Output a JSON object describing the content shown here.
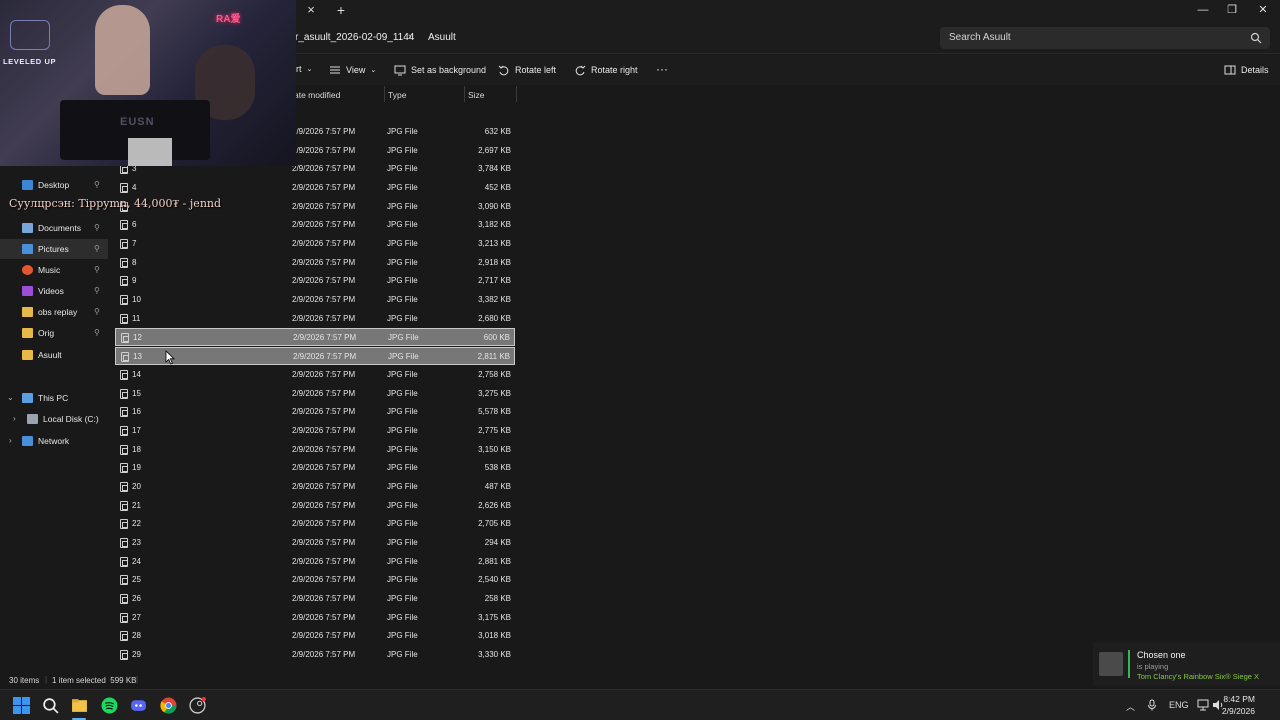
{
  "window": {
    "tab_close": "×",
    "new_tab": "+",
    "minimize": "—",
    "maximize": "❐",
    "close": "✕"
  },
  "address": {
    "crumb_parent": "r_asuult_2026-02-09_1144",
    "crumb_current": "Asuult",
    "search_placeholder": "Search Asuult"
  },
  "toolbar": {
    "sort_label": "rt",
    "view_label": "View",
    "set_background_label": "Set as background",
    "rotate_left_label": "Rotate left",
    "rotate_right_label": "Rotate right",
    "more_label": "···",
    "details_label": "Details"
  },
  "columns": {
    "date": "ate modified",
    "type": "Type",
    "size": "Size"
  },
  "nav": {
    "desktop": "Desktop",
    "documents": "Documents",
    "pictures": "Pictures",
    "music": "Music",
    "videos": "Videos",
    "obs_replay": "obs replay",
    "orig": "Orig",
    "asuult": "Asuult",
    "this_pc": "This PC",
    "local_disk": "Local Disk (C:)",
    "network": "Network"
  },
  "files": [
    {
      "name": "",
      "date": "2/9/2026 7:57 PM",
      "type": "JPG File",
      "size": "632 KB"
    },
    {
      "name": "",
      "date": "2/9/2026 7:57 PM",
      "type": "JPG File",
      "size": "2,697 KB"
    },
    {
      "name": "3",
      "date": "2/9/2026 7:57 PM",
      "type": "JPG File",
      "size": "3,784 KB"
    },
    {
      "name": "4",
      "date": "2/9/2026 7:57 PM",
      "type": "JPG File",
      "size": "452 KB"
    },
    {
      "name": "",
      "date": "2/9/2026 7:57 PM",
      "type": "JPG File",
      "size": "3,090 KB"
    },
    {
      "name": "6",
      "date": "2/9/2026 7:57 PM",
      "type": "JPG File",
      "size": "3,182 KB"
    },
    {
      "name": "7",
      "date": "2/9/2026 7:57 PM",
      "type": "JPG File",
      "size": "3,213 KB"
    },
    {
      "name": "8",
      "date": "2/9/2026 7:57 PM",
      "type": "JPG File",
      "size": "2,918 KB"
    },
    {
      "name": "9",
      "date": "2/9/2026 7:57 PM",
      "type": "JPG File",
      "size": "2,717 KB"
    },
    {
      "name": "10",
      "date": "2/9/2026 7:57 PM",
      "type": "JPG File",
      "size": "3,382 KB"
    },
    {
      "name": "11",
      "date": "2/9/2026 7:57 PM",
      "type": "JPG File",
      "size": "2,680 KB"
    },
    {
      "name": "12",
      "date": "2/9/2026 7:57 PM",
      "type": "JPG File",
      "size": "600 KB",
      "selected": true
    },
    {
      "name": "13",
      "date": "2/9/2026 7:57 PM",
      "type": "JPG File",
      "size": "2,811 KB",
      "selected": true
    },
    {
      "name": "14",
      "date": "2/9/2026 7:57 PM",
      "type": "JPG File",
      "size": "2,758 KB"
    },
    {
      "name": "15",
      "date": "2/9/2026 7:57 PM",
      "type": "JPG File",
      "size": "3,275 KB"
    },
    {
      "name": "16",
      "date": "2/9/2026 7:57 PM",
      "type": "JPG File",
      "size": "5,578 KB"
    },
    {
      "name": "17",
      "date": "2/9/2026 7:57 PM",
      "type": "JPG File",
      "size": "2,775 KB"
    },
    {
      "name": "18",
      "date": "2/9/2026 7:57 PM",
      "type": "JPG File",
      "size": "3,150 KB"
    },
    {
      "name": "19",
      "date": "2/9/2026 7:57 PM",
      "type": "JPG File",
      "size": "538 KB"
    },
    {
      "name": "20",
      "date": "2/9/2026 7:57 PM",
      "type": "JPG File",
      "size": "487 KB"
    },
    {
      "name": "21",
      "date": "2/9/2026 7:57 PM",
      "type": "JPG File",
      "size": "2,626 KB"
    },
    {
      "name": "22",
      "date": "2/9/2026 7:57 PM",
      "type": "JPG File",
      "size": "2,705 KB"
    },
    {
      "name": "23",
      "date": "2/9/2026 7:57 PM",
      "type": "JPG File",
      "size": "294 KB"
    },
    {
      "name": "24",
      "date": "2/9/2026 7:57 PM",
      "type": "JPG File",
      "size": "2,881 KB"
    },
    {
      "name": "25",
      "date": "2/9/2026 7:57 PM",
      "type": "JPG File",
      "size": "2,540 KB"
    },
    {
      "name": "26",
      "date": "2/9/2026 7:57 PM",
      "type": "JPG File",
      "size": "258 KB"
    },
    {
      "name": "27",
      "date": "2/9/2026 7:57 PM",
      "type": "JPG File",
      "size": "3,175 KB"
    },
    {
      "name": "28",
      "date": "2/9/2026 7:57 PM",
      "type": "JPG File",
      "size": "3,018 KB"
    },
    {
      "name": "29",
      "date": "2/9/2026 7:57 PM",
      "type": "JPG File",
      "size": "3,330 KB"
    }
  ],
  "status": {
    "items": "30 items",
    "selected": "1 item selected  599 KB"
  },
  "taskbar": {
    "language": "ENG",
    "time": "8:42 PM",
    "date": "2/9/2026"
  },
  "notification": {
    "name": "Chosen one",
    "status": "is playing",
    "game": "Tom Clancy's Rainbow Six® Siege X"
  },
  "overlay": {
    "logo": "LEVELED UP",
    "neon": "RA爱",
    "brand": "EUSN",
    "tip_text": "Суулцрсэн: Tippymn, 44,000₮ - jennd"
  },
  "colors": {
    "background": "#191919",
    "selected_row": "#777777",
    "accent_green": "#3cb54a",
    "game_green": "#86c547",
    "folder_yellow": "#e8b84a",
    "pictures_blue": "#4a8fd8"
  }
}
